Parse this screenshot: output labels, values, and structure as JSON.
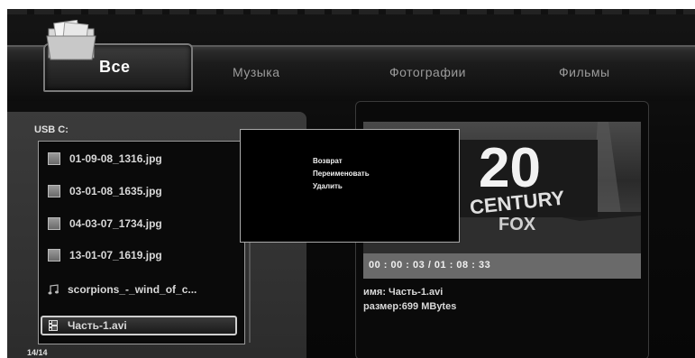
{
  "tabs": [
    {
      "label": "Все",
      "active": true
    },
    {
      "label": "Музыка",
      "active": false
    },
    {
      "label": "Фотографии",
      "active": false
    },
    {
      "label": "Фильмы",
      "active": false
    }
  ],
  "file_browser": {
    "drive_label": "USB C:",
    "items": [
      {
        "name": "01-09-08_1316.jpg",
        "icon": "image-icon"
      },
      {
        "name": "03-01-08_1635.jpg",
        "icon": "image-icon"
      },
      {
        "name": "04-03-07_1734.jpg",
        "icon": "image-icon"
      },
      {
        "name": "13-01-07_1619.jpg",
        "icon": "image-icon"
      },
      {
        "name": "scorpions_-_wind_of_c...",
        "icon": "music-note-icon"
      },
      {
        "name": "Часть-1.avi",
        "icon": "film-icon",
        "selected": true
      }
    ],
    "page_count": "14/14"
  },
  "context_menu": {
    "items": [
      "Возврат",
      "Переименовать",
      "Удалить"
    ]
  },
  "preview": {
    "time": "00 : 00 : 03 / 01 : 08 : 33",
    "name_line": "имя: Часть-1.avi",
    "size_line": "размер:699 MBytes"
  }
}
